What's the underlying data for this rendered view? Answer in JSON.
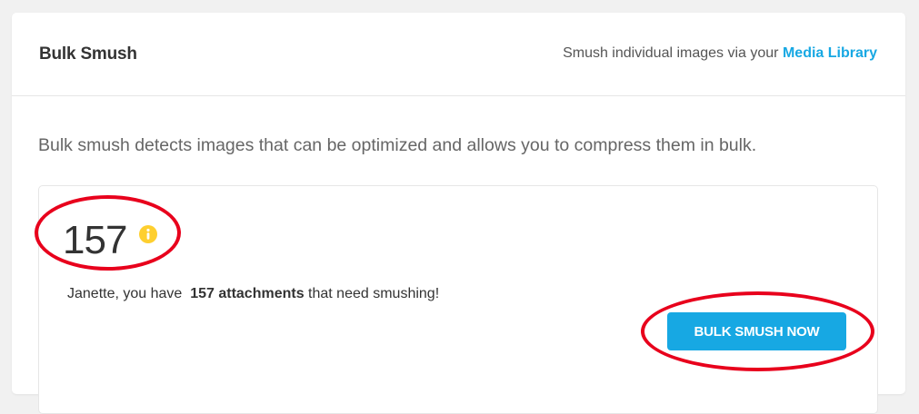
{
  "header": {
    "title": "Bulk Smush",
    "hint_prefix": "Smush individual images via your",
    "hint_link": "Media Library"
  },
  "main": {
    "description": "Bulk smush detects images that can be optimized and allows you to compress them in bulk.",
    "count": "157",
    "message_prefix": "Janette, you have",
    "message_count": "157 attachments",
    "message_suffix": "that need smushing!",
    "button_label": "BULK SMUSH NOW"
  },
  "icons": {
    "info": "info-icon"
  },
  "colors": {
    "accent": "#17a8e3",
    "info_icon": "#fecf2f",
    "annotation": "#e8001c",
    "background": "#f1f1f1"
  }
}
